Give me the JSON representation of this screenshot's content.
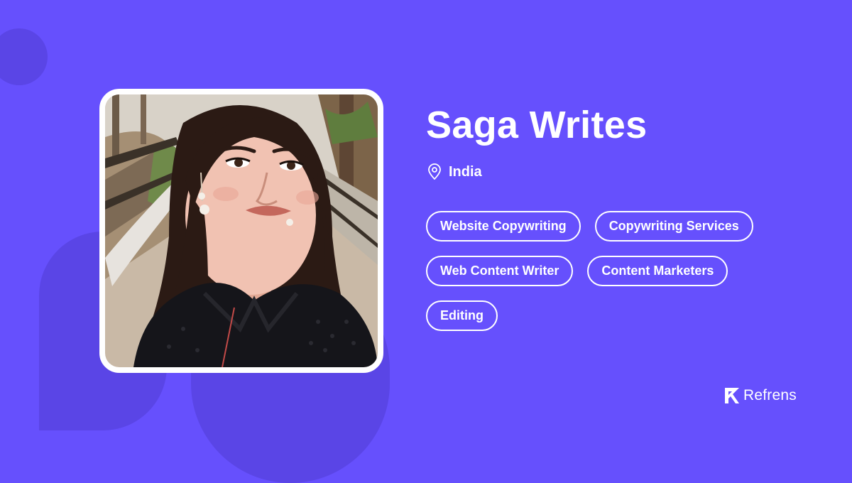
{
  "profile": {
    "name": "Saga Writes",
    "location": "India",
    "photo_alt": "profile-photo"
  },
  "tags": [
    "Website Copywriting",
    "Copywriting Services",
    "Web Content Writer",
    "Content Marketers",
    "Editing"
  ],
  "brand": {
    "name": "Refrens"
  },
  "icons": {
    "location": "map-pin-icon",
    "brand": "refrens-logo-icon"
  },
  "colors": {
    "background": "#6650fd",
    "shape": "#5a45e6",
    "text": "#ffffff"
  }
}
